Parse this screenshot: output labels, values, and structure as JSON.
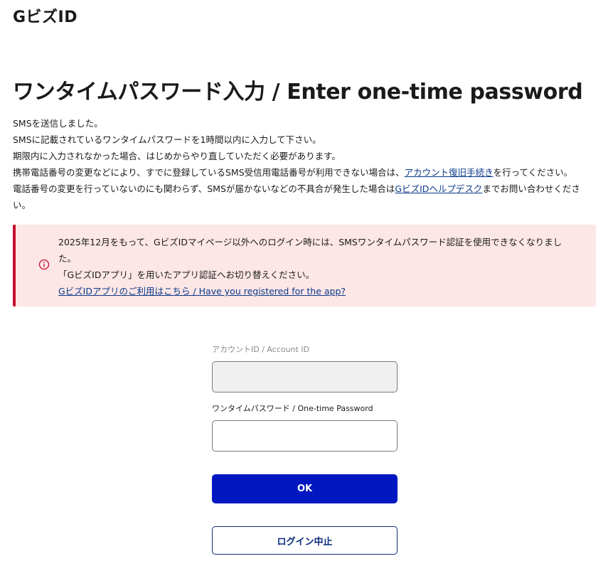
{
  "header": {
    "logo": "GビズID"
  },
  "page": {
    "title": "ワンタイムパスワード入力 / Enter one-time password"
  },
  "intro": {
    "line1": "SMSを送信しました。",
    "line2": "SMSに記載されているワンタイムパスワードを1時間以内に入力して下さい。",
    "line3": "期限内に入力されなかった場合、はじめからやり直していただく必要があります。",
    "line4_before": "携帯電話番号の変更などにより、すでに登録しているSMS受信用電話番号が利用できない場合は、",
    "line4_link": "アカウント復旧手続き",
    "line4_after": "を行ってください。",
    "line5_before": "電話番号の変更を行っていないのにも関わらず、SMSが届かないなどの不具合が発生した場合は",
    "line5_link": "GビズIDヘルプデスク",
    "line5_after": "までお問い合わせください。"
  },
  "alert": {
    "icon": "info-circle-icon",
    "message": "2025年12月をもって、GビズIDマイページ以外へのログイン時には、SMSワンタイムパスワード認証を使用できなくなりました。",
    "sub_message": "「GビズIDアプリ」を用いたアプリ認証へお切り替えください。",
    "link": "GビズIDアプリのご利用はこちら / Have you registered for the app?",
    "bg_color": "#fde6e6",
    "border_color": "#c8102e"
  },
  "form": {
    "account_id_label": "アカウントID / Account ID",
    "account_id_value": "",
    "otp_label": "ワンタイムパスワード / One-time Password",
    "otp_value": "",
    "ok_label": "OK",
    "cancel_label": "ログイン中止",
    "primary_color": "#0017c1"
  }
}
